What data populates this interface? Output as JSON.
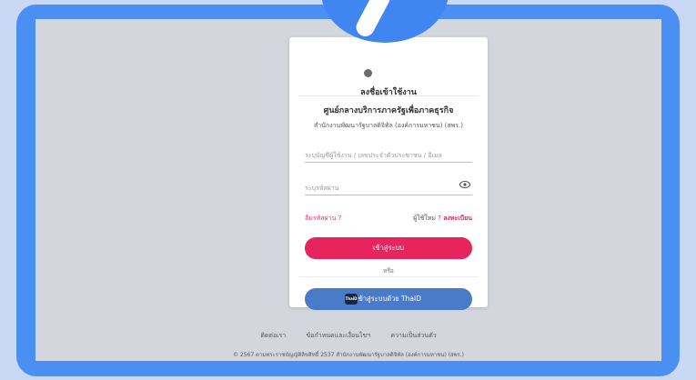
{
  "login_card": {
    "title": "ลงชื่อเข้าใช้งาน",
    "subtitle": "ศูนย์กลางบริการภาครัฐเพื่อภาคธุรกิจ",
    "organization": "สำนักงานพัฒนารัฐบาลดิจิทัล (องค์การมหาชน) (สพร.)",
    "username_placeholder": "ระบุบัญชีผู้ใช้งาน / เลขประจำตัวประชาชน / อีเมล",
    "password_placeholder": "ระบุรหัสผ่าน",
    "forgot_password": "ลืมรหัสผ่าน ?",
    "new_user_prefix": "ผู้ใช้ใหม่ ?",
    "register_link": "ลงทะเบียน",
    "login_button": "เข้าสู่ระบบ",
    "or_label": "หรือ",
    "thaid_button": "เข้าสู่ระบบด้วย ThaiD",
    "thaid_logo": "ThaiD"
  },
  "footer": {
    "contact": "ติดต่อเรา",
    "terms": "ข้อกำหนดและเงื่อนไขฯ",
    "privacy": "ความเป็นส่วนตัว",
    "copyright": "© 2567 ตามพระราชบัญญัติลิขสิทธิ์ 2537 สำนักงานพัฒนารัฐบาลดิจิทัล (องค์การมหาชน) (สพร.)"
  },
  "colors": {
    "frame": "#4a90f2",
    "primary_button": "#e8245f",
    "thaid_button": "#4a7bc9",
    "link_pink": "#e8336d"
  },
  "icons": [
    "eye-icon",
    "thaid-logo-icon",
    "logo-icon"
  ]
}
